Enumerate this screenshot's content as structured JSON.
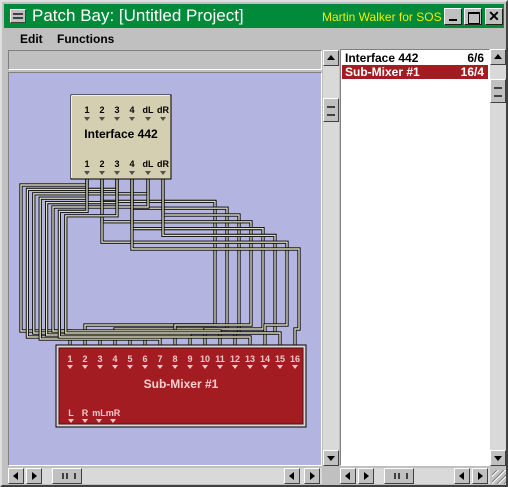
{
  "window": {
    "title": "Patch Bay: [Untitled Project]",
    "credit": "Martin Walker for SOS",
    "close_glyph": "✕"
  },
  "menu": {
    "edit": "Edit",
    "functions": "Functions"
  },
  "devices": {
    "interface": {
      "name": "Interface 442",
      "inputs": [
        "1",
        "2",
        "3",
        "4",
        "dL",
        "dR"
      ],
      "outputs": [
        "1",
        "2",
        "3",
        "4",
        "dL",
        "dR"
      ],
      "color": "#d4cfb0"
    },
    "submixer": {
      "name": "Sub-Mixer #1",
      "inputs": [
        "1",
        "2",
        "3",
        "4",
        "5",
        "6",
        "7",
        "8",
        "9",
        "10",
        "11",
        "12",
        "13",
        "14",
        "15",
        "16"
      ],
      "outputs": [
        "L",
        "R",
        "mL",
        "mR"
      ],
      "color": "#a31c22"
    }
  },
  "device_list": [
    {
      "name": "Interface 442",
      "count": "6/6",
      "selected": false
    },
    {
      "name": "Sub-Mixer #1",
      "count": "16/4",
      "selected": true
    }
  ],
  "colors": {
    "title_bar": "#008a3a",
    "canvas": "#b4b4e0",
    "credit": "#f0f000"
  }
}
